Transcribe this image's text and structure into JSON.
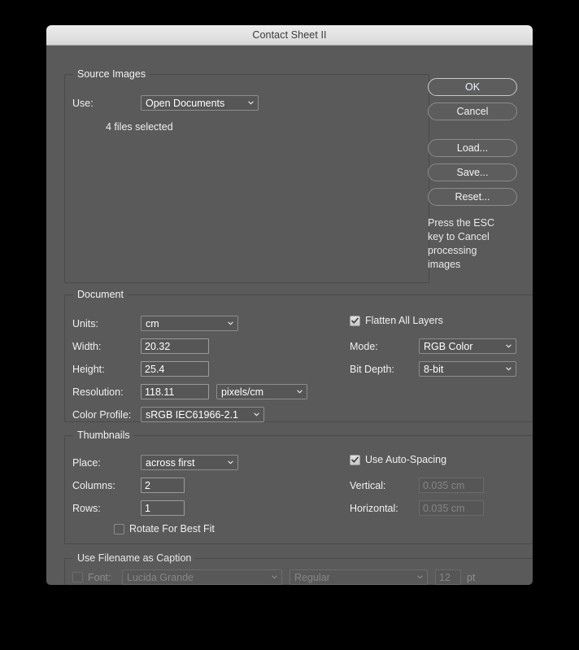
{
  "window": {
    "title": "Contact Sheet II"
  },
  "source_images": {
    "legend": "Source Images",
    "use_label": "Use:",
    "use_value": "Open Documents",
    "status": "4 files selected"
  },
  "buttons": {
    "ok": "OK",
    "cancel": "Cancel",
    "load": "Load...",
    "save": "Save...",
    "reset": "Reset...",
    "esc_note": "Press the ESC key to Cancel processing images"
  },
  "document": {
    "legend": "Document",
    "units_label": "Units:",
    "units_value": "cm",
    "width_label": "Width:",
    "width_value": "20.32",
    "height_label": "Height:",
    "height_value": "25.4",
    "resolution_label": "Resolution:",
    "resolution_value": "118.11",
    "resolution_units_value": "pixels/cm",
    "color_profile_label": "Color Profile:",
    "color_profile_value": "sRGB IEC61966-2.1",
    "flatten_label": "Flatten All Layers",
    "flatten_checked": true,
    "mode_label": "Mode:",
    "mode_value": "RGB Color",
    "bit_depth_label": "Bit Depth:",
    "bit_depth_value": "8-bit"
  },
  "thumbnails": {
    "legend": "Thumbnails",
    "place_label": "Place:",
    "place_value": "across first",
    "columns_label": "Columns:",
    "columns_value": "2",
    "rows_label": "Rows:",
    "rows_value": "1",
    "rotate_label": "Rotate For Best Fit",
    "rotate_checked": false,
    "auto_spacing_label": "Use Auto-Spacing",
    "auto_spacing_checked": true,
    "vertical_label": "Vertical:",
    "vertical_value": "0.035 cm",
    "horizontal_label": "Horizontal:",
    "horizontal_value": "0.035 cm"
  },
  "caption": {
    "legend": "Use Filename as Caption",
    "font_label": "Font:",
    "font_checked": false,
    "font_family_value": "Lucida Grande",
    "font_style_value": "Regular",
    "font_size_value": "12",
    "font_size_unit": "pt"
  },
  "colors": {
    "dialog_background": "#5a5a5a",
    "titlebar": "#e6e6e6",
    "text": "#f0f0f0",
    "disabled_text": "#868686",
    "default_button_border": "#c9c9c9"
  }
}
